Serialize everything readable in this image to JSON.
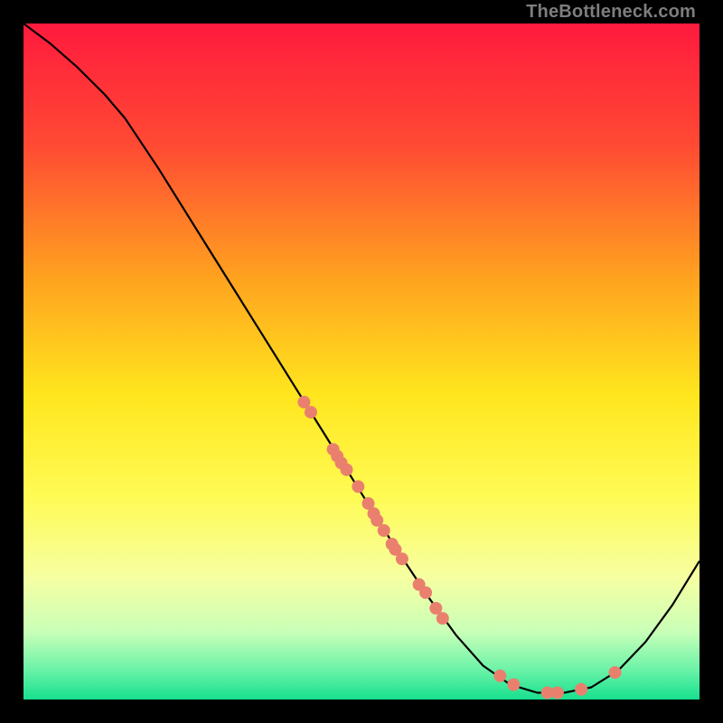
{
  "watermark_text": "TheBottleneck.com",
  "chart_data": {
    "type": "line",
    "title": "",
    "xlabel": "",
    "ylabel": "",
    "xlim": [
      0,
      100
    ],
    "ylim": [
      0,
      100
    ],
    "grid": false,
    "legend": false,
    "background_gradient_stops": [
      {
        "offset": 0.0,
        "color": "#ff1a3e"
      },
      {
        "offset": 0.18,
        "color": "#ff4a33"
      },
      {
        "offset": 0.38,
        "color": "#ffa41f"
      },
      {
        "offset": 0.55,
        "color": "#ffe61e"
      },
      {
        "offset": 0.7,
        "color": "#fffb55"
      },
      {
        "offset": 0.82,
        "color": "#f6ffa2"
      },
      {
        "offset": 0.9,
        "color": "#c9ffb8"
      },
      {
        "offset": 0.955,
        "color": "#6cf3a8"
      },
      {
        "offset": 1.0,
        "color": "#17e08f"
      }
    ],
    "series": [
      {
        "name": "curve",
        "stroke": "#000000",
        "stroke_width": 2.2,
        "points": [
          {
            "x": 0.0,
            "y": 100.0
          },
          {
            "x": 4.0,
            "y": 97.0
          },
          {
            "x": 8.0,
            "y": 93.5
          },
          {
            "x": 12.0,
            "y": 89.5
          },
          {
            "x": 15.0,
            "y": 86.0
          },
          {
            "x": 17.0,
            "y": 83.0
          },
          {
            "x": 20.0,
            "y": 78.5
          },
          {
            "x": 25.0,
            "y": 70.5
          },
          {
            "x": 30.0,
            "y": 62.5
          },
          {
            "x": 35.0,
            "y": 54.5
          },
          {
            "x": 40.0,
            "y": 46.5
          },
          {
            "x": 45.0,
            "y": 38.5
          },
          {
            "x": 50.0,
            "y": 30.5
          },
          {
            "x": 55.0,
            "y": 22.5
          },
          {
            "x": 60.0,
            "y": 15.0
          },
          {
            "x": 64.0,
            "y": 9.5
          },
          {
            "x": 68.0,
            "y": 5.0
          },
          {
            "x": 72.0,
            "y": 2.2
          },
          {
            "x": 76.0,
            "y": 1.0
          },
          {
            "x": 80.0,
            "y": 1.0
          },
          {
            "x": 84.0,
            "y": 1.8
          },
          {
            "x": 88.0,
            "y": 4.3
          },
          {
            "x": 92.0,
            "y": 8.5
          },
          {
            "x": 96.0,
            "y": 14.0
          },
          {
            "x": 100.0,
            "y": 20.5
          }
        ]
      }
    ],
    "scatter_overlay": {
      "name": "points",
      "fill": "#e9806e",
      "radius": 7,
      "points": [
        {
          "x": 41.5,
          "y": 44.0
        },
        {
          "x": 42.5,
          "y": 42.5
        },
        {
          "x": 45.8,
          "y": 37.0
        },
        {
          "x": 46.4,
          "y": 36.0
        },
        {
          "x": 47.0,
          "y": 35.0
        },
        {
          "x": 47.8,
          "y": 34.0
        },
        {
          "x": 49.5,
          "y": 31.5
        },
        {
          "x": 51.0,
          "y": 29.0
        },
        {
          "x": 51.8,
          "y": 27.5
        },
        {
          "x": 52.3,
          "y": 26.5
        },
        {
          "x": 53.3,
          "y": 25.0
        },
        {
          "x": 54.5,
          "y": 23.0
        },
        {
          "x": 55.0,
          "y": 22.2
        },
        {
          "x": 56.0,
          "y": 20.8
        },
        {
          "x": 58.5,
          "y": 17.0
        },
        {
          "x": 59.5,
          "y": 15.8
        },
        {
          "x": 61.0,
          "y": 13.5
        },
        {
          "x": 62.0,
          "y": 12.0
        },
        {
          "x": 70.5,
          "y": 3.5
        },
        {
          "x": 72.5,
          "y": 2.2
        },
        {
          "x": 77.5,
          "y": 1.0
        },
        {
          "x": 79.0,
          "y": 1.0
        },
        {
          "x": 82.5,
          "y": 1.5
        },
        {
          "x": 87.5,
          "y": 4.0
        }
      ]
    }
  }
}
